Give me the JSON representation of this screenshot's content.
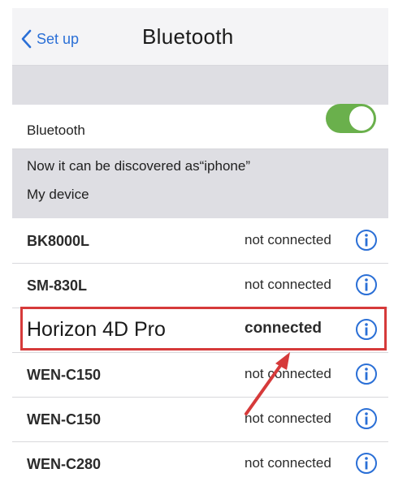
{
  "nav": {
    "back_label": "Set up",
    "title": "Bluetooth"
  },
  "bluetooth": {
    "label": "Bluetooth",
    "toggle_on": true,
    "toggle_color": "#6ab04c"
  },
  "info": {
    "discoverable_text": "Now it can be discovered as“iphone”",
    "my_device_label": "My device"
  },
  "devices": [
    {
      "name": "BK8000L",
      "status": "not connected"
    },
    {
      "name": "SM-830L",
      "status": "not connected"
    },
    {
      "name": "Horizon 4D Pro",
      "status": "connected"
    },
    {
      "name": "WEN-C150",
      "status": "not connected"
    },
    {
      "name": "WEN-C150",
      "status": "not connected"
    },
    {
      "name": "WEN-C280",
      "status": "not connected"
    }
  ],
  "colors": {
    "accent": "#2a6fd6",
    "highlight": "#d63a3a",
    "info_icon": "#2a6fd6"
  }
}
